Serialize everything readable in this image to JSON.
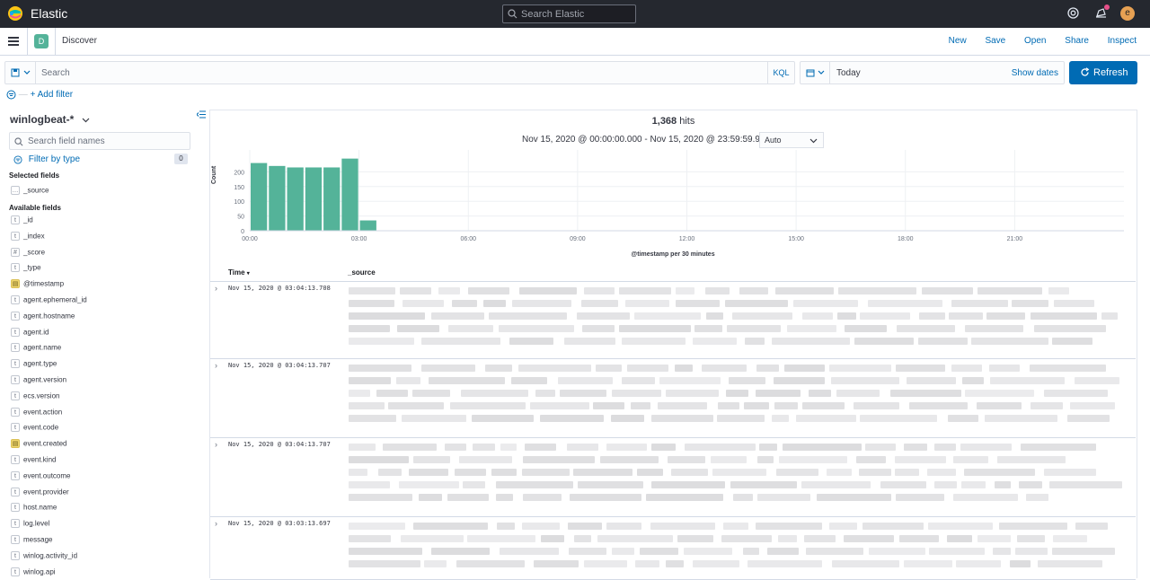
{
  "topbar": {
    "brand": "Elastic",
    "search_placeholder": "Search Elastic",
    "user_initial": "e"
  },
  "navbar": {
    "app_badge": "D",
    "app_title": "Discover",
    "links": [
      "New",
      "Save",
      "Open",
      "Share",
      "Inspect"
    ]
  },
  "query": {
    "placeholder": "Search",
    "language": "KQL"
  },
  "date": {
    "value": "Today",
    "show_dates": "Show dates",
    "refresh": "Refresh"
  },
  "filters": {
    "add_filter": "+ Add filter"
  },
  "sidebar": {
    "index_pattern": "winlogbeat-*",
    "field_search_placeholder": "Search field names",
    "filter_by_type": "Filter by type",
    "filter_count": "0",
    "selected_title": "Selected fields",
    "selected": [
      {
        "type": "src",
        "name": "_source"
      }
    ],
    "available_title": "Available fields",
    "available": [
      {
        "type": "t",
        "name": "_id"
      },
      {
        "type": "t",
        "name": "_index"
      },
      {
        "type": "#",
        "name": "_score"
      },
      {
        "type": "t",
        "name": "_type"
      },
      {
        "type": "date",
        "name": "@timestamp"
      },
      {
        "type": "t",
        "name": "agent.ephemeral_id"
      },
      {
        "type": "t",
        "name": "agent.hostname"
      },
      {
        "type": "t",
        "name": "agent.id"
      },
      {
        "type": "t",
        "name": "agent.name"
      },
      {
        "type": "t",
        "name": "agent.type"
      },
      {
        "type": "t",
        "name": "agent.version"
      },
      {
        "type": "t",
        "name": "ecs.version"
      },
      {
        "type": "t",
        "name": "event.action"
      },
      {
        "type": "t",
        "name": "event.code"
      },
      {
        "type": "date",
        "name": "event.created"
      },
      {
        "type": "t",
        "name": "event.kind"
      },
      {
        "type": "t",
        "name": "event.outcome"
      },
      {
        "type": "t",
        "name": "event.provider"
      },
      {
        "type": "t",
        "name": "host.name"
      },
      {
        "type": "t",
        "name": "log.level"
      },
      {
        "type": "t",
        "name": "message"
      },
      {
        "type": "t",
        "name": "winlog.activity_id"
      },
      {
        "type": "t",
        "name": "winlog.api"
      }
    ]
  },
  "main": {
    "hits_count": "1,368",
    "hits_label": "hits",
    "time_range": "Nov 15, 2020 @ 00:00:00.000 - Nov 15, 2020 @ 23:59:59.999",
    "interval": "Auto",
    "table_headers": [
      "Time",
      "_source"
    ],
    "rows": [
      "Nov 15, 2020 @ 03:04:13.708",
      "Nov 15, 2020 @ 03:04:13.707",
      "Nov 15, 2020 @ 03:04:13.707",
      "Nov 15, 2020 @ 03:03:13.697"
    ]
  },
  "chart_data": {
    "type": "bar",
    "x": [
      "00:00",
      "00:30",
      "01:00",
      "01:30",
      "02:00",
      "02:30",
      "03:00"
    ],
    "values": [
      230,
      220,
      215,
      215,
      215,
      245,
      35
    ],
    "xticks": [
      "00:00",
      "03:00",
      "06:00",
      "09:00",
      "12:00",
      "15:00",
      "18:00",
      "21:00"
    ],
    "yticks": [
      0,
      50,
      100,
      150,
      200
    ],
    "ylim": [
      0,
      250
    ],
    "xlabel": "@timestamp per 30 minutes",
    "ylabel": "Count",
    "color": "#54b399"
  }
}
